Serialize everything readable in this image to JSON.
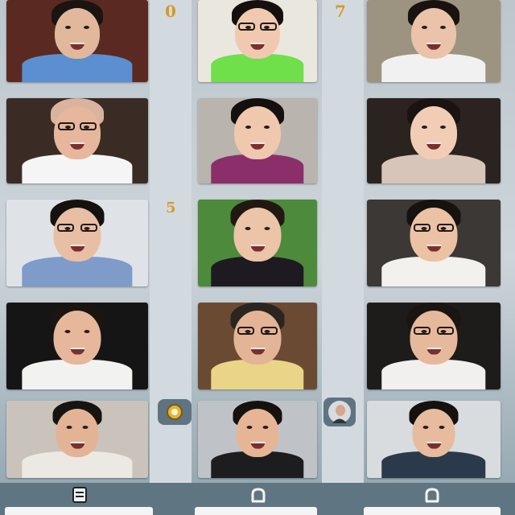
{
  "window": {
    "markers": {
      "top_left": "0",
      "top_right": "7",
      "middle": "5"
    }
  },
  "participants": [
    {
      "id": "p1",
      "shirt": "#5b8fd0",
      "bg": "#5a2a22",
      "hair": "#1b1410",
      "glasses": false
    },
    {
      "id": "p2",
      "shirt": "#6fe04a",
      "bg": "#eae7df",
      "hair": "#15100d",
      "glasses": true
    },
    {
      "id": "p3",
      "shirt": "#f1f1f1",
      "bg": "#9c9480",
      "hair": "#1a120f",
      "glasses": false
    },
    {
      "id": "p4",
      "shirt": "#f5f5f5",
      "bg": "#3b2b25",
      "hair": "#d9b39d",
      "glasses": true
    },
    {
      "id": "p5",
      "shirt": "#8b2f6a",
      "bg": "#b9b4ae",
      "hair": "#14100d",
      "glasses": false
    },
    {
      "id": "p6",
      "shirt": "#d6c5b8",
      "bg": "#2a2320",
      "hair": "#1b1311",
      "glasses": false
    },
    {
      "id": "p7",
      "shirt": "#7e9bc9",
      "bg": "#dfe3e8",
      "hair": "#15110e",
      "glasses": true
    },
    {
      "id": "p8",
      "shirt": "#1e1a22",
      "bg": "#4d8a3b",
      "hair": "#221812",
      "glasses": false
    },
    {
      "id": "p9",
      "shirt": "#f3f1ee",
      "bg": "#3c3836",
      "hair": "#161210",
      "glasses": true
    },
    {
      "id": "p10",
      "shirt": "#f2f2f0",
      "bg": "#151515",
      "hair": "#1b1512",
      "glasses": false
    },
    {
      "id": "p11",
      "shirt": "#ead487",
      "bg": "#6b4a33",
      "hair": "#2a2521",
      "glasses": true
    },
    {
      "id": "p12",
      "shirt": "#f2f0ee",
      "bg": "#1e1c1b",
      "hair": "#1b1512",
      "glasses": true
    },
    {
      "id": "p13",
      "shirt": "#ece8e2",
      "bg": "#c9c3bb",
      "hair": "#171310",
      "glasses": false
    },
    {
      "id": "p14",
      "shirt": "#1d1d1f",
      "bg": "#bfc3c7",
      "hair": "#15110e",
      "glasses": false
    },
    {
      "id": "p15",
      "shirt": "#2b3a4a",
      "bg": "#d9dcdf",
      "hair": "#15110e",
      "glasses": false
    }
  ],
  "controls": {
    "icons": [
      "settings-icon",
      "participant-thumb-icon"
    ],
    "bottom_icons": [
      "list-icon",
      "share-icon",
      "share-icon-2"
    ]
  },
  "colors": {
    "accent": "#d69a2a",
    "bar": "#5f7682"
  }
}
